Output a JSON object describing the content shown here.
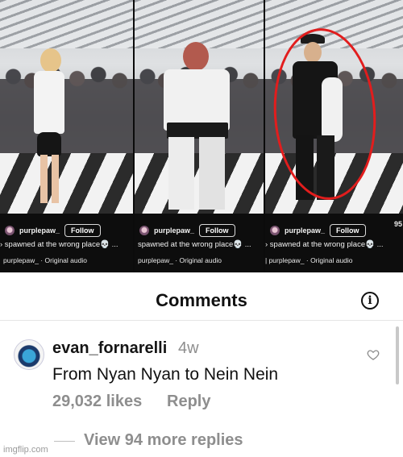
{
  "frames": [
    {
      "creator": "purplepaw_",
      "follow_label": "Follow",
      "caption": "› spawned at the wrong place💀 ...",
      "audio": "purplepaw_ · Original audio",
      "side_number": ""
    },
    {
      "creator": "purplepaw_",
      "follow_label": "Follow",
      "caption": "spawned at the wrong place💀 ...",
      "audio": "purplepaw_ · Original audio",
      "side_number": ""
    },
    {
      "creator": "purplepaw_",
      "follow_label": "Follow",
      "caption": "› spawned at the wrong place💀 ...",
      "audio": "| purplepaw_ · Original audio",
      "side_number": "95"
    }
  ],
  "comments": {
    "title": "Comments",
    "info_icon": "info-icon",
    "comment": {
      "username": "evan_fornarelli",
      "time": "4w",
      "text": "From Nyan Nyan to Nein Nein",
      "likes": "29,032 likes",
      "reply_label": "Reply",
      "like_icon": "heart-icon"
    },
    "view_replies": "View 94 more replies"
  },
  "watermark": "imgflip.com",
  "colors": {
    "highlight_circle": "#e21d1d",
    "muted_text": "#8e8e8e",
    "video_bg": "#0d0d0d"
  }
}
